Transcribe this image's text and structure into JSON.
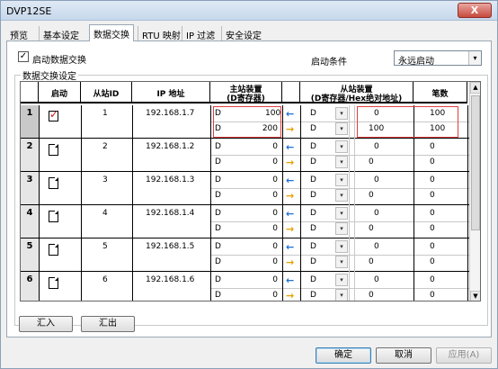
{
  "window": {
    "title": "DVP12SE",
    "close": "X"
  },
  "tabs": [
    {
      "label": "预览"
    },
    {
      "label": "基本设定"
    },
    {
      "label": "数据交换"
    },
    {
      "label": "RTU 映射"
    },
    {
      "label": "IP 过滤"
    },
    {
      "label": "安全设定"
    }
  ],
  "enable_exchange": {
    "label": "启动数据交换",
    "checked": true,
    "mark": "✓"
  },
  "start_condition": {
    "label": "启动条件",
    "value": "永远启动"
  },
  "group": {
    "label": "数据交换设定"
  },
  "grid": {
    "headers": {
      "enable": "启动",
      "slave_id": "从站ID",
      "ip": "IP 地址",
      "master_1": "主站装置",
      "master_2": "(D寄存器)",
      "slave_1": "从站装置",
      "slave_2": "(D寄存器/Hex绝对地址)",
      "count": "笔数"
    },
    "rows": [
      {
        "num": "1",
        "enabled": true,
        "slave_id": "1",
        "ip": "192.168.1.7",
        "m1_dev": "D",
        "m1_val": "100",
        "m2_dev": "D",
        "m2_val": "200",
        "s1_dev": "D",
        "s1_val": "0",
        "s2_dev": "D",
        "s2_val": "100",
        "c1": "100",
        "c2": "100"
      },
      {
        "num": "2",
        "enabled": false,
        "slave_id": "2",
        "ip": "192.168.1.2",
        "m1_dev": "D",
        "m1_val": "0",
        "m2_dev": "D",
        "m2_val": "0",
        "s1_dev": "D",
        "s1_val": "0",
        "s2_dev": "D",
        "s2_val": "0",
        "c1": "0",
        "c2": "0"
      },
      {
        "num": "3",
        "enabled": false,
        "slave_id": "3",
        "ip": "192.168.1.3",
        "m1_dev": "D",
        "m1_val": "0",
        "m2_dev": "D",
        "m2_val": "0",
        "s1_dev": "D",
        "s1_val": "0",
        "s2_dev": "D",
        "s2_val": "0",
        "c1": "0",
        "c2": "0"
      },
      {
        "num": "4",
        "enabled": false,
        "slave_id": "4",
        "ip": "192.168.1.4",
        "m1_dev": "D",
        "m1_val": "0",
        "m2_dev": "D",
        "m2_val": "0",
        "s1_dev": "D",
        "s1_val": "0",
        "s2_dev": "D",
        "s2_val": "0",
        "c1": "0",
        "c2": "0"
      },
      {
        "num": "5",
        "enabled": false,
        "slave_id": "5",
        "ip": "192.168.1.5",
        "m1_dev": "D",
        "m1_val": "0",
        "m2_dev": "D",
        "m2_val": "0",
        "s1_dev": "D",
        "s1_val": "0",
        "s2_dev": "D",
        "s2_val": "0",
        "c1": "0",
        "c2": "0"
      },
      {
        "num": "6",
        "enabled": false,
        "slave_id": "6",
        "ip": "192.168.1.6",
        "m1_dev": "D",
        "m1_val": "0",
        "m2_dev": "D",
        "m2_val": "0",
        "s1_dev": "D",
        "s1_val": "0",
        "s2_dev": "D",
        "s2_val": "0",
        "c1": "0",
        "c2": "0"
      }
    ],
    "arrow_left": "←",
    "arrow_right": "→",
    "dropdown_glyph": "▾"
  },
  "buttons": {
    "import": "汇入",
    "export": "汇出",
    "ok": "确定",
    "cancel": "取消",
    "apply": "应用(A)"
  },
  "colors": {
    "check_mark": "#d01818",
    "highlight_box": "#e04040",
    "arrow_left": "#1e6fd6",
    "arrow_right": "#e8a000"
  }
}
